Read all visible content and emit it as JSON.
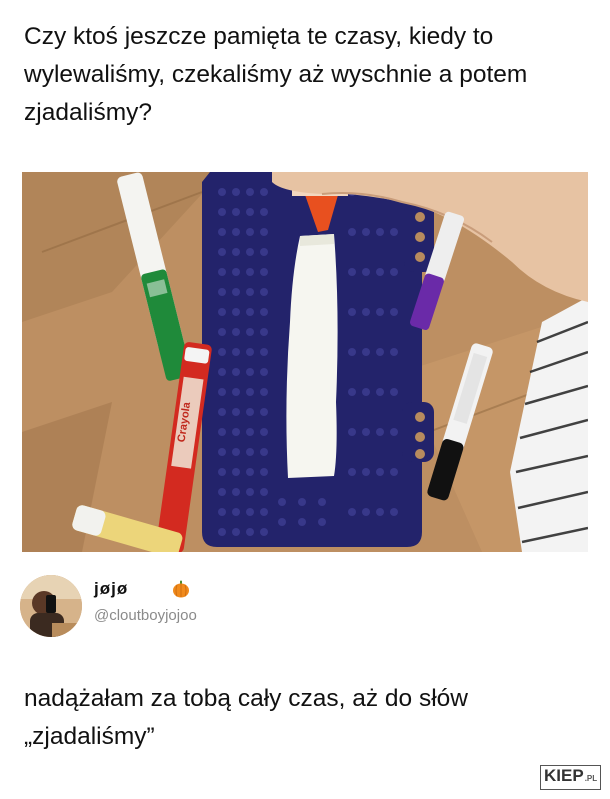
{
  "post": {
    "caption": "Czy ktoś jeszcze pamięta te czasy, kiedy to wylewaliśmy, czekaliśmy aż wyschnie a potem zjadaliśmy?"
  },
  "tweet": {
    "author_name": "jøjø",
    "author_handle": "@cloutboyjojoo",
    "reply_text": "nadążałam za tobą cały czas, aż do słów „zjadaliśmy”",
    "emoji_icon": "pumpkin-icon"
  },
  "photo": {
    "marker_label": "Crayola"
  },
  "watermark": {
    "main": "KIEP",
    "suffix": ".PL"
  }
}
